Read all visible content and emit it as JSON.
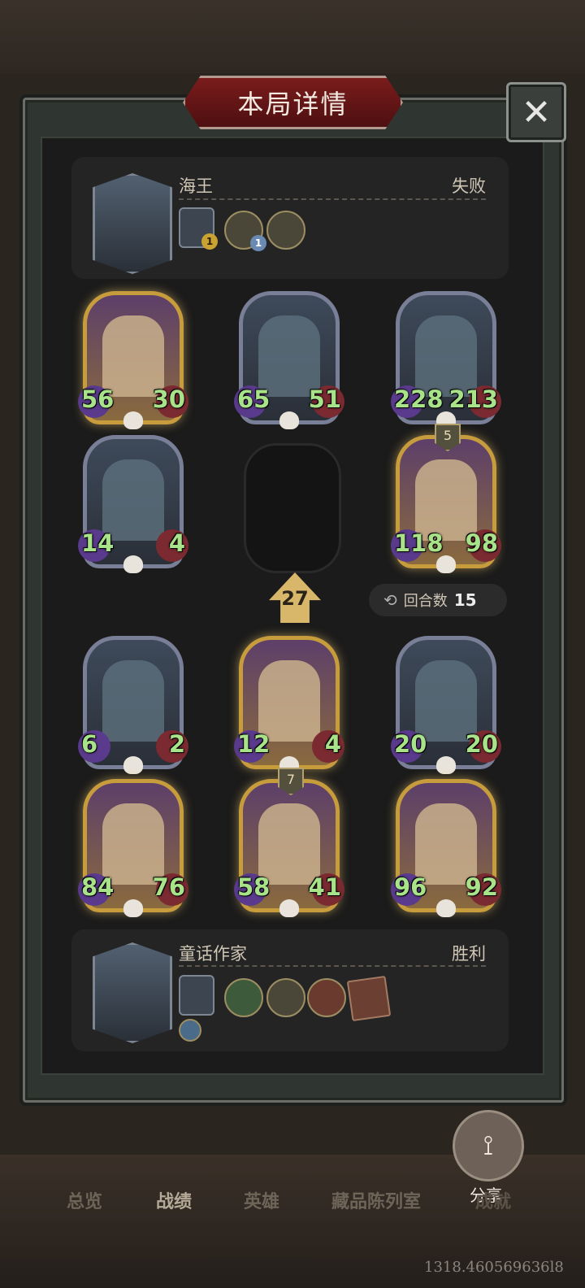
{
  "window": {
    "title": "本局详情"
  },
  "loser": {
    "name": "海王",
    "result": "失败",
    "items": [
      {
        "badge": "1"
      },
      {
        "badge": "1"
      },
      {
        "badge": ""
      }
    ]
  },
  "winner": {
    "name": "童话作家",
    "result": "胜利"
  },
  "enemy_board": [
    {
      "atk": "56",
      "hp": "30",
      "tier": "",
      "gold": true
    },
    {
      "atk": "65",
      "hp": "51",
      "tier": "",
      "gold": false
    },
    {
      "atk": "228",
      "hp": "213",
      "tier": "",
      "gold": false
    },
    {
      "atk": "14",
      "hp": "4",
      "tier": "",
      "gold": false
    },
    {
      "atk": "118",
      "hp": "98",
      "tier": "5",
      "gold": true
    }
  ],
  "center": {
    "level": "27"
  },
  "rounds": {
    "label": "回合数",
    "value": "15"
  },
  "player_board": [
    {
      "atk": "6",
      "hp": "2",
      "tier": "",
      "gold": false
    },
    {
      "atk": "12",
      "hp": "4",
      "tier": "",
      "gold": true
    },
    {
      "atk": "20",
      "hp": "20",
      "tier": "",
      "gold": false
    },
    {
      "atk": "84",
      "hp": "76",
      "tier": "",
      "gold": true
    },
    {
      "atk": "58",
      "hp": "41",
      "tier": "7",
      "gold": true
    },
    {
      "atk": "96",
      "hp": "92",
      "tier": "",
      "gold": true
    }
  ],
  "share": {
    "label": "分享"
  },
  "tabs": [
    {
      "label": "总览"
    },
    {
      "label": "战绩"
    },
    {
      "label": "英雄"
    },
    {
      "label": "藏品陈列室"
    },
    {
      "label": "成就"
    }
  ],
  "debug_text": "1318.460569636l8",
  "icons": {
    "close": "close-icon",
    "share": "share-icon",
    "rounds": "refresh-icon",
    "skull": "skull-icon",
    "arrow": "up-arrow-icon"
  }
}
